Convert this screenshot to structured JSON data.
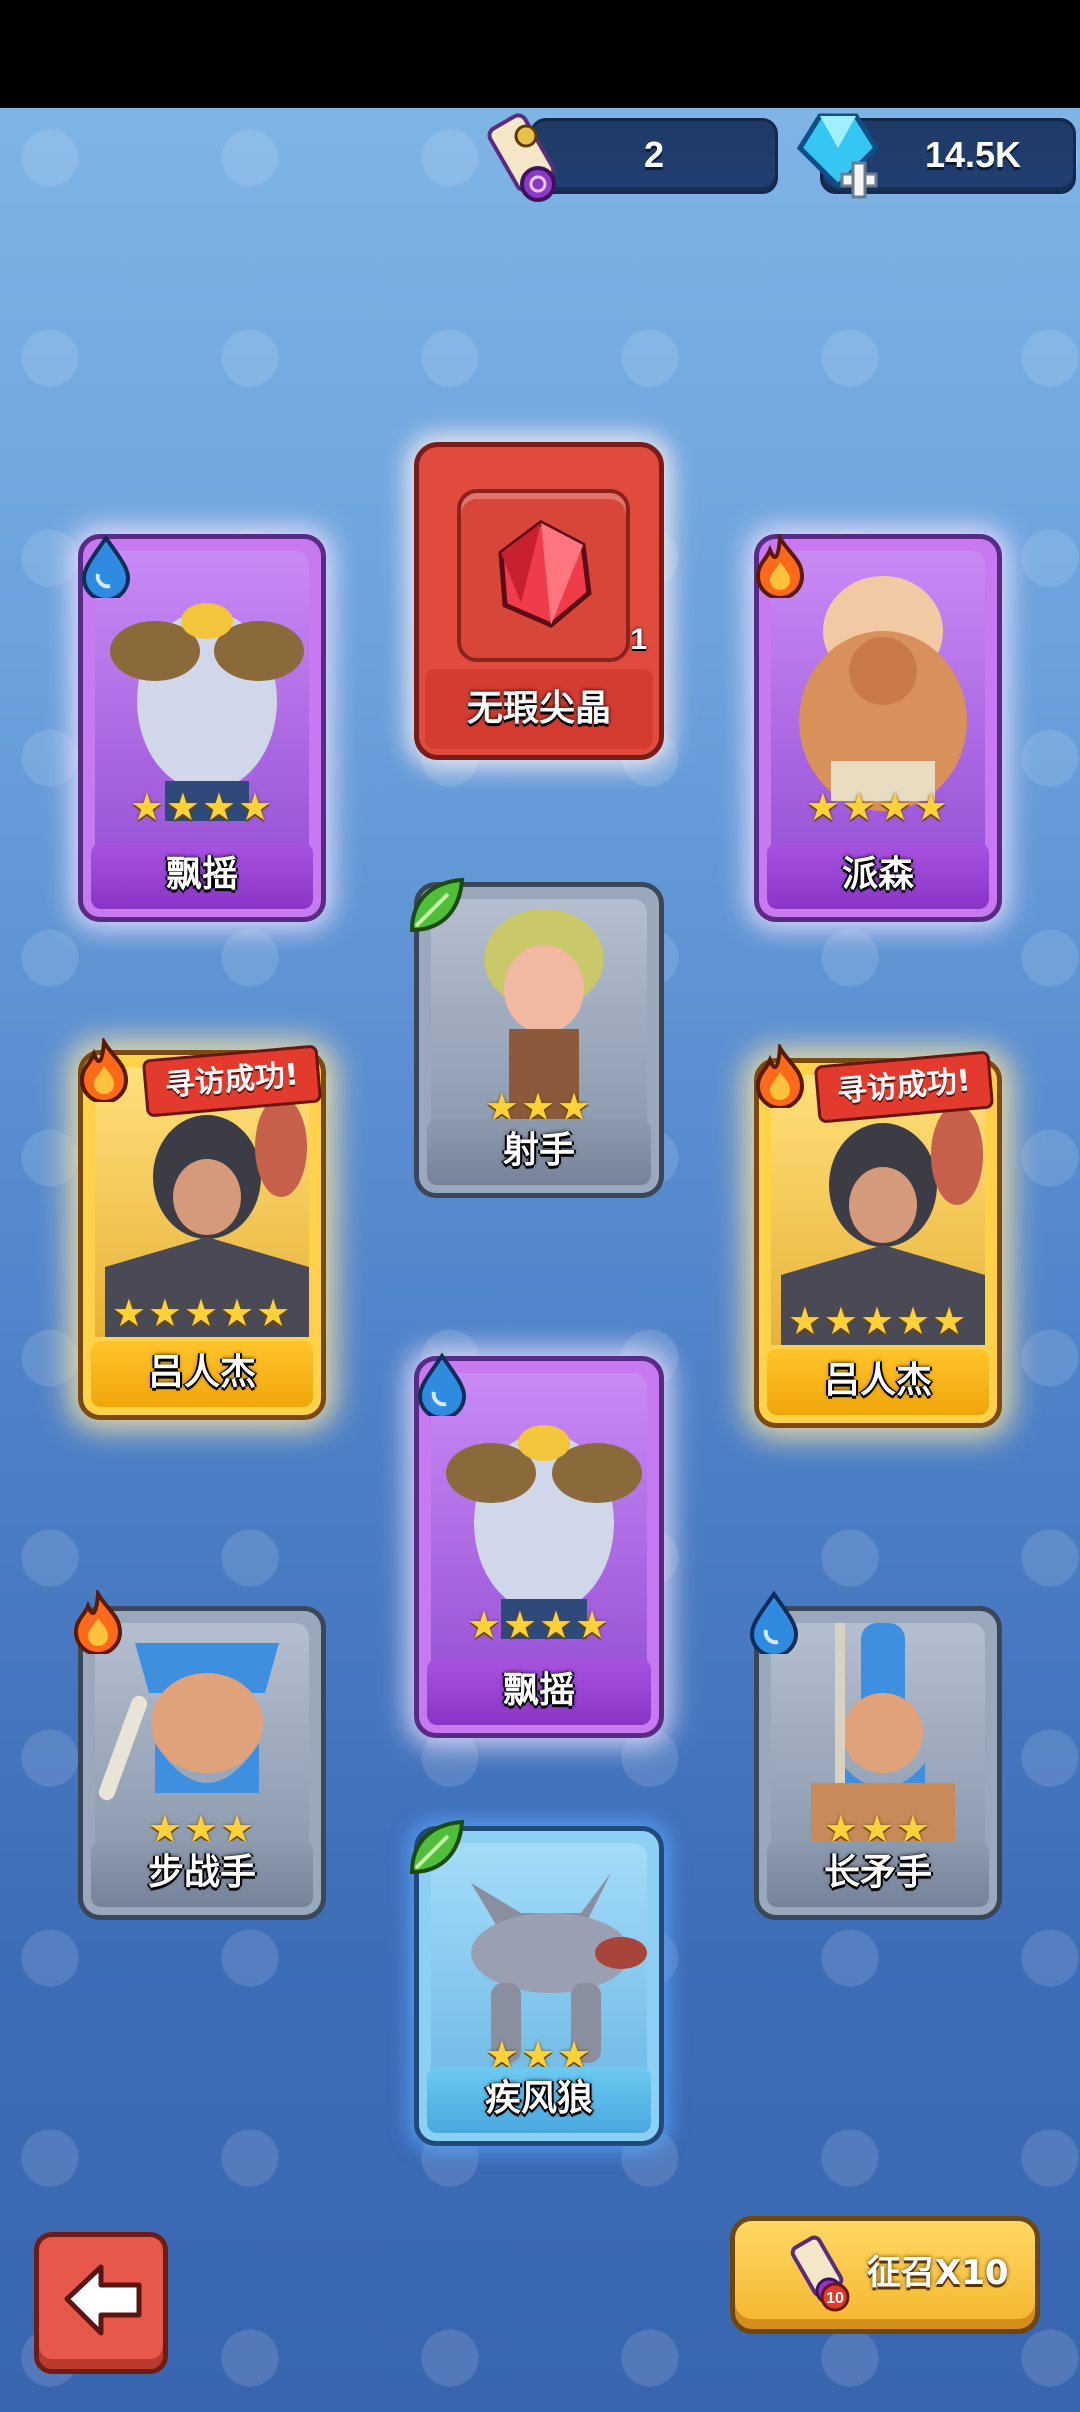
{
  "header": {
    "scrolls_count": "2",
    "gems_count": "14.5K"
  },
  "item_card": {
    "name": "无瑕尖晶",
    "count": "1"
  },
  "cards": [
    {
      "name": "飘摇",
      "stars": "★★★★",
      "element": "water",
      "rarity": "purple"
    },
    {
      "name": "派森",
      "stars": "★★★★",
      "element": "fire",
      "rarity": "purple"
    },
    {
      "name": "射手",
      "stars": "★★★",
      "element": "leaf",
      "rarity": "gray"
    },
    {
      "name": "吕人杰",
      "stars": "★★★★★",
      "element": "fire",
      "rarity": "gold",
      "banner": "寻访成功!"
    },
    {
      "name": "吕人杰",
      "stars": "★★★★★",
      "element": "fire",
      "rarity": "gold",
      "banner": "寻访成功!"
    },
    {
      "name": "飘摇",
      "stars": "★★★★",
      "element": "water",
      "rarity": "purple"
    },
    {
      "name": "步战手",
      "stars": "★★★",
      "element": "fire",
      "rarity": "gray"
    },
    {
      "name": "长矛手",
      "stars": "★★★",
      "element": "water",
      "rarity": "gray"
    },
    {
      "name": "疾风狼",
      "stars": "★★★",
      "element": "leaf",
      "rarity": "blue"
    }
  ],
  "footer": {
    "recruit_label": "征召X10",
    "recruit_badge": "10"
  },
  "colors": {
    "fire": "#ff6a1a",
    "water": "#2f8be0",
    "leaf": "#4fbf3a"
  }
}
